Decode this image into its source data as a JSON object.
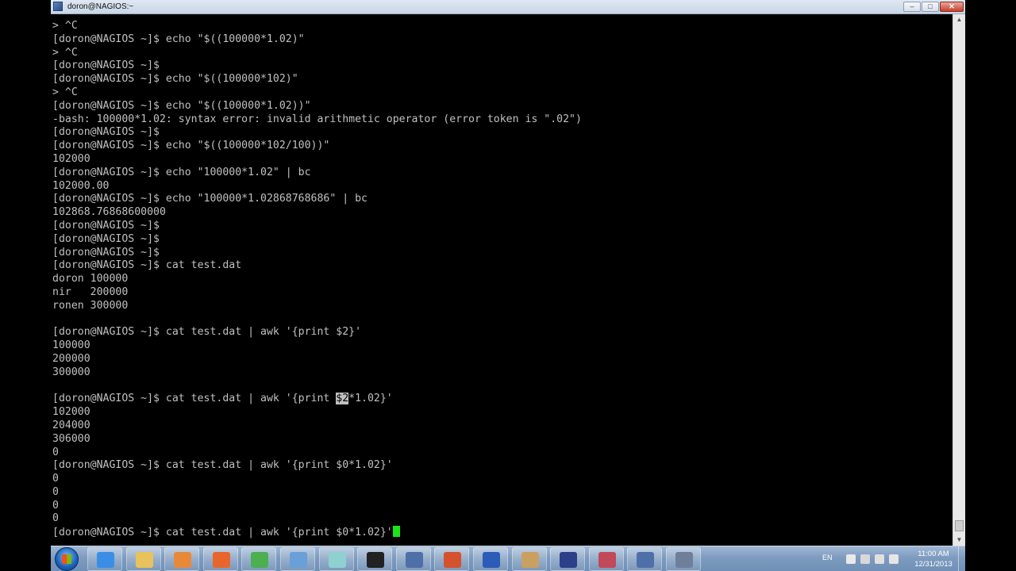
{
  "window": {
    "title": "doron@NAGIOS:~",
    "controls": {
      "minimize": "–",
      "maximize": "□",
      "close": "✕"
    }
  },
  "terminal": {
    "lines": [
      "> ^C",
      "[doron@NAGIOS ~]$ echo \"$((100000*1.02)\"",
      "> ^C",
      "[doron@NAGIOS ~]$",
      "[doron@NAGIOS ~]$ echo \"$((100000*102)\"",
      "> ^C",
      "[doron@NAGIOS ~]$ echo \"$((100000*1.02))\"",
      "-bash: 100000*1.02: syntax error: invalid arithmetic operator (error token is \".02\")",
      "[doron@NAGIOS ~]$",
      "[doron@NAGIOS ~]$ echo \"$((100000*102/100))\"",
      "102000",
      "[doron@NAGIOS ~]$ echo \"100000*1.02\" | bc",
      "102000.00",
      "[doron@NAGIOS ~]$ echo \"100000*1.02868768686\" | bc",
      "102868.76868600000",
      "[doron@NAGIOS ~]$",
      "[doron@NAGIOS ~]$",
      "[doron@NAGIOS ~]$",
      "[doron@NAGIOS ~]$ cat test.dat",
      "doron 100000",
      "nir   200000",
      "ronen 300000",
      "",
      "[doron@NAGIOS ~]$ cat test.dat | awk '{print $2}'",
      "100000",
      "200000",
      "300000",
      "",
      "SELECTED_LINE",
      "102000",
      "204000",
      "306000",
      "0",
      "[doron@NAGIOS ~]$ cat test.dat | awk '{print $0*1.02}'",
      "0",
      "0",
      "0",
      "0",
      "CURSOR_LINE"
    ],
    "selected_line": {
      "before": "[doron@NAGIOS ~]$ cat test.dat | awk '{print ",
      "selected": "$2",
      "after": "*1.02}'"
    },
    "current_input": "[doron@NAGIOS ~]$ cat test.dat | awk '{print $0*1.02}'"
  },
  "taskbar": {
    "items": [
      "internet-explorer-icon",
      "file-explorer-icon",
      "media-player-icon",
      "firefox-icon",
      "chrome-icon",
      "lync-icon",
      "notepad-icon",
      "command-prompt-icon",
      "putty-icon",
      "powerpoint-icon",
      "word-icon",
      "paint-icon",
      "save-icon",
      "balls-icon",
      "putty-icon-2",
      "virtualbox-icon"
    ],
    "language": "EN",
    "time": "11:00 AM",
    "date": "12/31/2013"
  },
  "colors": {
    "terminal_bg": "#000000",
    "terminal_fg": "#c0c0c0",
    "cursor": "#19e619"
  }
}
